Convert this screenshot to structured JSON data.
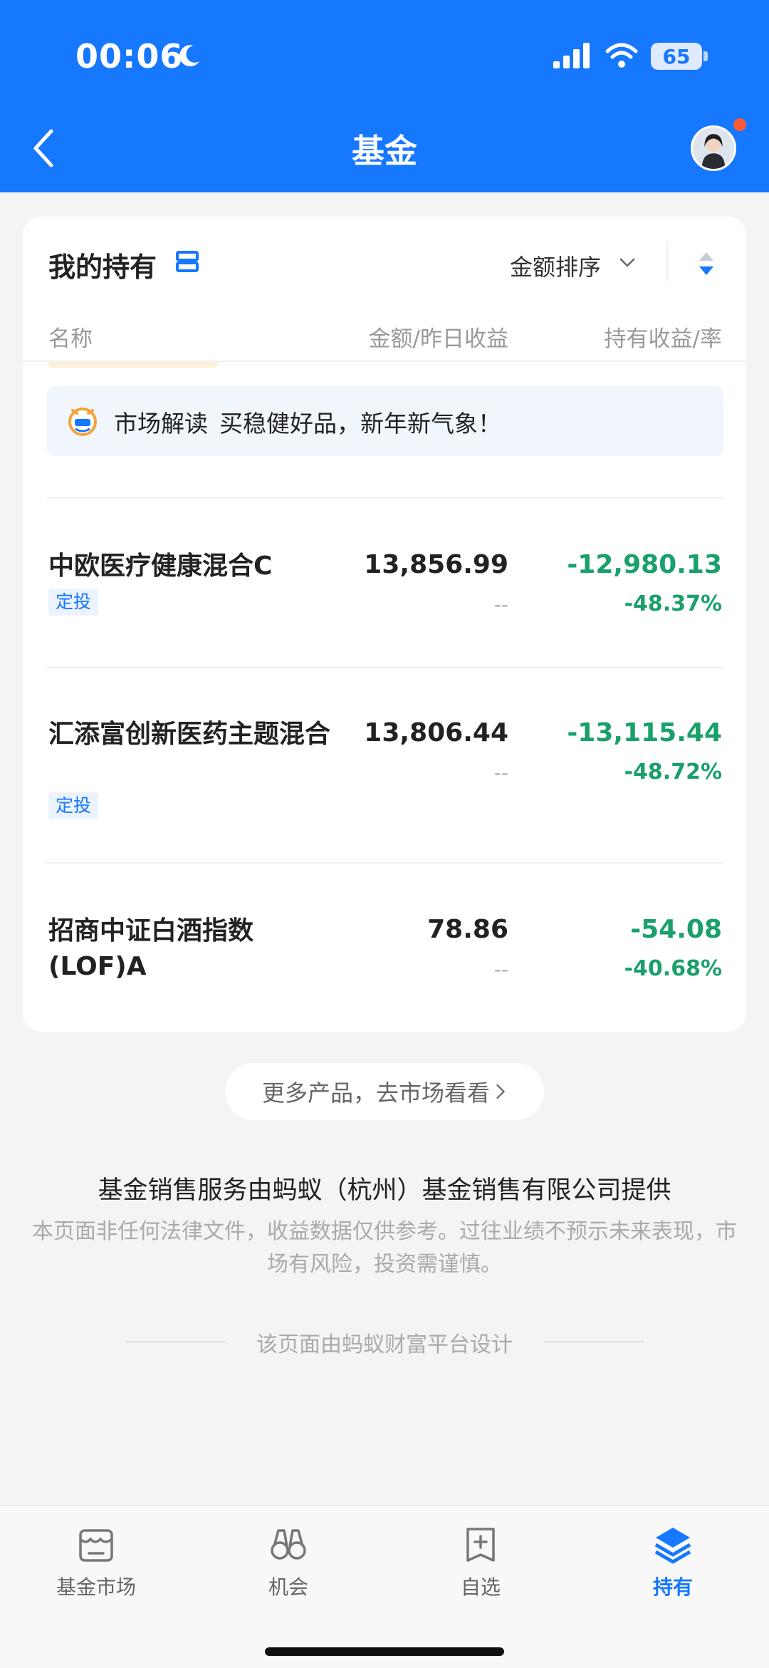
{
  "status_bar": {
    "time": "00:06",
    "battery": "65"
  },
  "nav": {
    "title": "基金"
  },
  "holdings": {
    "title": "我的持有",
    "sort_label": "金额排序",
    "columns": {
      "name": "名称",
      "amount": "金额/昨日收益",
      "profit": "持有收益/率"
    },
    "banner": {
      "label": "市场解读",
      "text": "买稳健好品，新年新气象！"
    },
    "funds": [
      {
        "name": "中欧医疗健康混合C",
        "tag": "定投",
        "amount": "13,856.99",
        "yesterday": "--",
        "profit": "-12,980.13",
        "rate": "-48.37%"
      },
      {
        "name": "汇添富创新医药主题混合",
        "tag": "定投",
        "amount": "13,806.44",
        "yesterday": "--",
        "profit": "-13,115.44",
        "rate": "-48.72%"
      },
      {
        "name": "招商中证白酒指数(LOF)A",
        "tag": "",
        "amount": "78.86",
        "yesterday": "--",
        "profit": "-54.08",
        "rate": "-40.68%"
      }
    ]
  },
  "more_button": "更多产品，去市场看看",
  "footer": {
    "provider": "基金销售服务由蚂蚁（杭州）基金销售有限公司提供",
    "disclaimer": "本页面非任何法律文件，收益数据仅供参考。过往业绩不预示未来表现，市场有风险，投资需谨慎。",
    "designed_by": "该页面由蚂蚁财富平台设计"
  },
  "tabbar": [
    {
      "label": "基金市场",
      "icon": "market-icon"
    },
    {
      "label": "机会",
      "icon": "binoculars-icon"
    },
    {
      "label": "自选",
      "icon": "watchlist-icon"
    },
    {
      "label": "持有",
      "icon": "layers-icon",
      "active": true
    }
  ],
  "colors": {
    "brand": "#1677ff",
    "loss": "#1aa06a",
    "avatar_badge": "#ff5a36"
  }
}
